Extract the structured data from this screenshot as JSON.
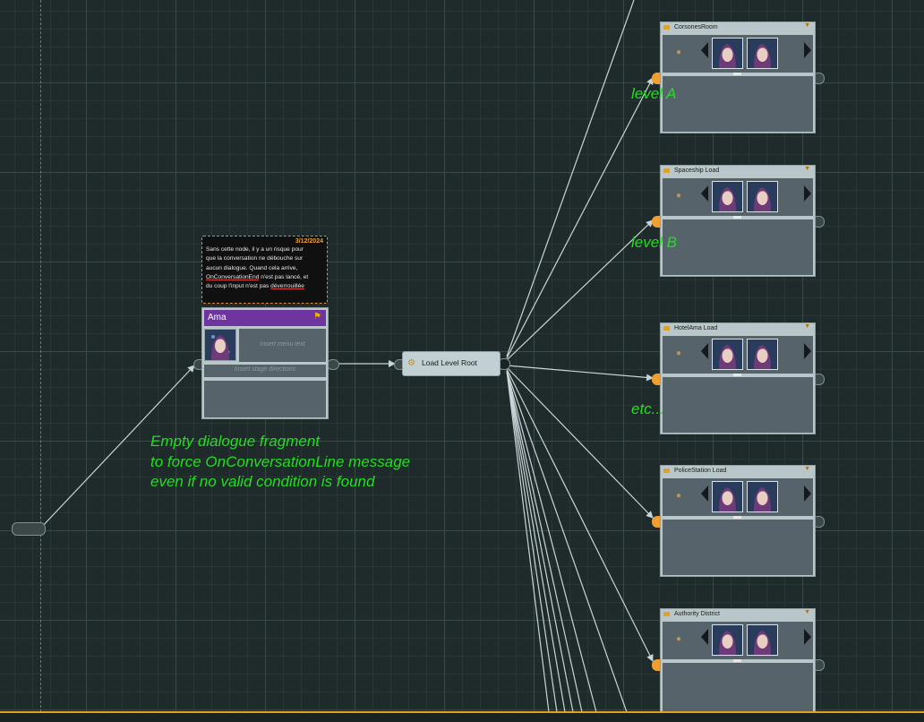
{
  "note": {
    "date": "3/12/2024",
    "line1": "Sans cette node, il y a un risque pour",
    "line2": "que la conversation ne débouche sur",
    "line3": "aucun dialogue. Quand cela arrive,",
    "line4_link": "OnConversationEnd",
    "line4_rest": " n'est pas lancé, et",
    "line5_start": "du coup l'input n'est pas ",
    "line5_link": "déverrouillée"
  },
  "fragment": {
    "speaker": "Ama",
    "menu_placeholder": "Insert menu text",
    "stage_placeholder": "Insert stage directions"
  },
  "hub": {
    "label": "Load Level Root"
  },
  "conditions": [
    {
      "name": "CorsonesRoom"
    },
    {
      "name": "Spaceship Load"
    },
    {
      "name": "HotelAma Load"
    },
    {
      "name": "PoliceStation Load"
    },
    {
      "name": "Authority District"
    }
  ],
  "annotations": {
    "level_a": "level A",
    "level_b": "level B",
    "etc": "etc...",
    "comment_line1": "Empty dialogue fragment",
    "comment_line2": "to force OnConversationLine message",
    "comment_line3": "even if no valid condition is found"
  },
  "colors": {
    "canvas": "#1f2b2b",
    "node": "#b9c7ca",
    "speaker_header": "#6e35a0",
    "annotation": "#22dd22",
    "accent": "#f0a030"
  }
}
